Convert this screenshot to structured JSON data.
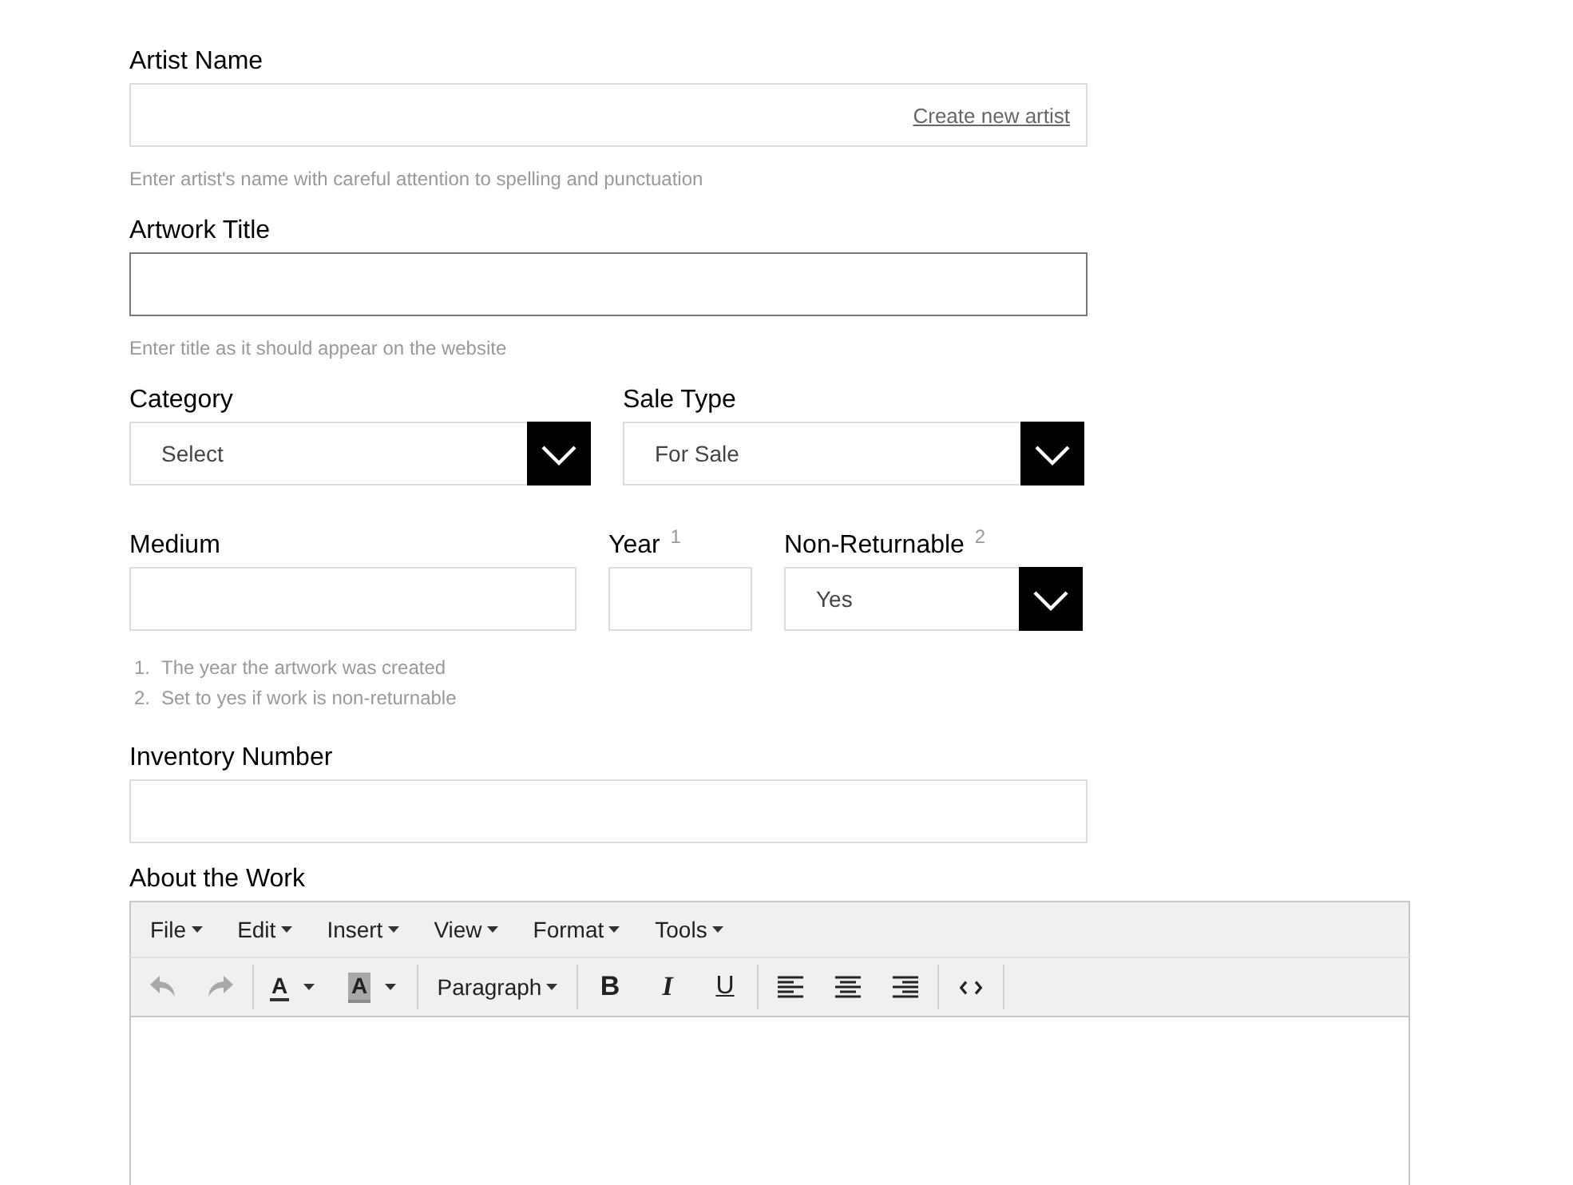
{
  "artist_name": {
    "label": "Artist Name",
    "link": "Create new artist",
    "help": "Enter artist's name with careful attention to spelling and punctuation",
    "focused": false
  },
  "artwork_title": {
    "label": "Artwork Title",
    "help": "Enter title as it should appear on the website",
    "focused": true
  },
  "row_1": [
    {
      "kind": "select",
      "label": "Category",
      "value": "Select",
      "focused": false
    },
    {
      "kind": "select",
      "label": "Sale Type",
      "value": "For Sale",
      "focused": false
    }
  ],
  "row_2": [
    {
      "kind": "input",
      "label": "Medium",
      "focused": false
    },
    {
      "kind": "input",
      "label": "Year $^{1}$",
      "focused": false
    },
    {
      "kind": "select",
      "label": "Non-Returnable $^{2}$",
      "value": "Yes",
      "focused": false
    }
  ],
  "footnotes": [
    {
      "number": "1.",
      "text": "The year the artwork was created"
    },
    {
      "number": "2.",
      "text": "Set to yes if work is non-returnable"
    }
  ],
  "inventory_number": {
    "label": "Inventory Number",
    "focused": false
  },
  "about_the_work": {
    "label": "About the Work",
    "menu": [
      {
        "label": "File"
      },
      {
        "label": "Edit"
      },
      {
        "label": "Insert"
      },
      {
        "label": "View"
      },
      {
        "label": "Format"
      },
      {
        "label": "Tools"
      }
    ],
    "toolbar": [
      [
        {
          "kind": "undo",
          "disabled": true
        },
        {
          "kind": "redo",
          "disabled": true
        }
      ],
      [
        {
          "kind": "text-color",
          "glyph": "A",
          "disabled": false
        },
        {
          "kind": "background-color",
          "glyph": "A",
          "disabled": false
        }
      ],
      [
        {
          "kind": "block-format",
          "label": "Paragraph",
          "disabled": false
        }
      ],
      [
        {
          "kind": "bold",
          "glyph": "B",
          "disabled": false
        },
        {
          "kind": "italic",
          "glyph": "I",
          "disabled": false
        },
        {
          "kind": "underline",
          "glyph": "U",
          "disabled": false
        }
      ],
      [
        {
          "kind": "align-left",
          "disabled": false
        },
        {
          "kind": "align-center",
          "disabled": false
        },
        {
          "kind": "align-right",
          "disabled": false
        }
      ],
      [
        {
          "kind": "source-code",
          "disabled": false
        }
      ]
    ]
  }
}
